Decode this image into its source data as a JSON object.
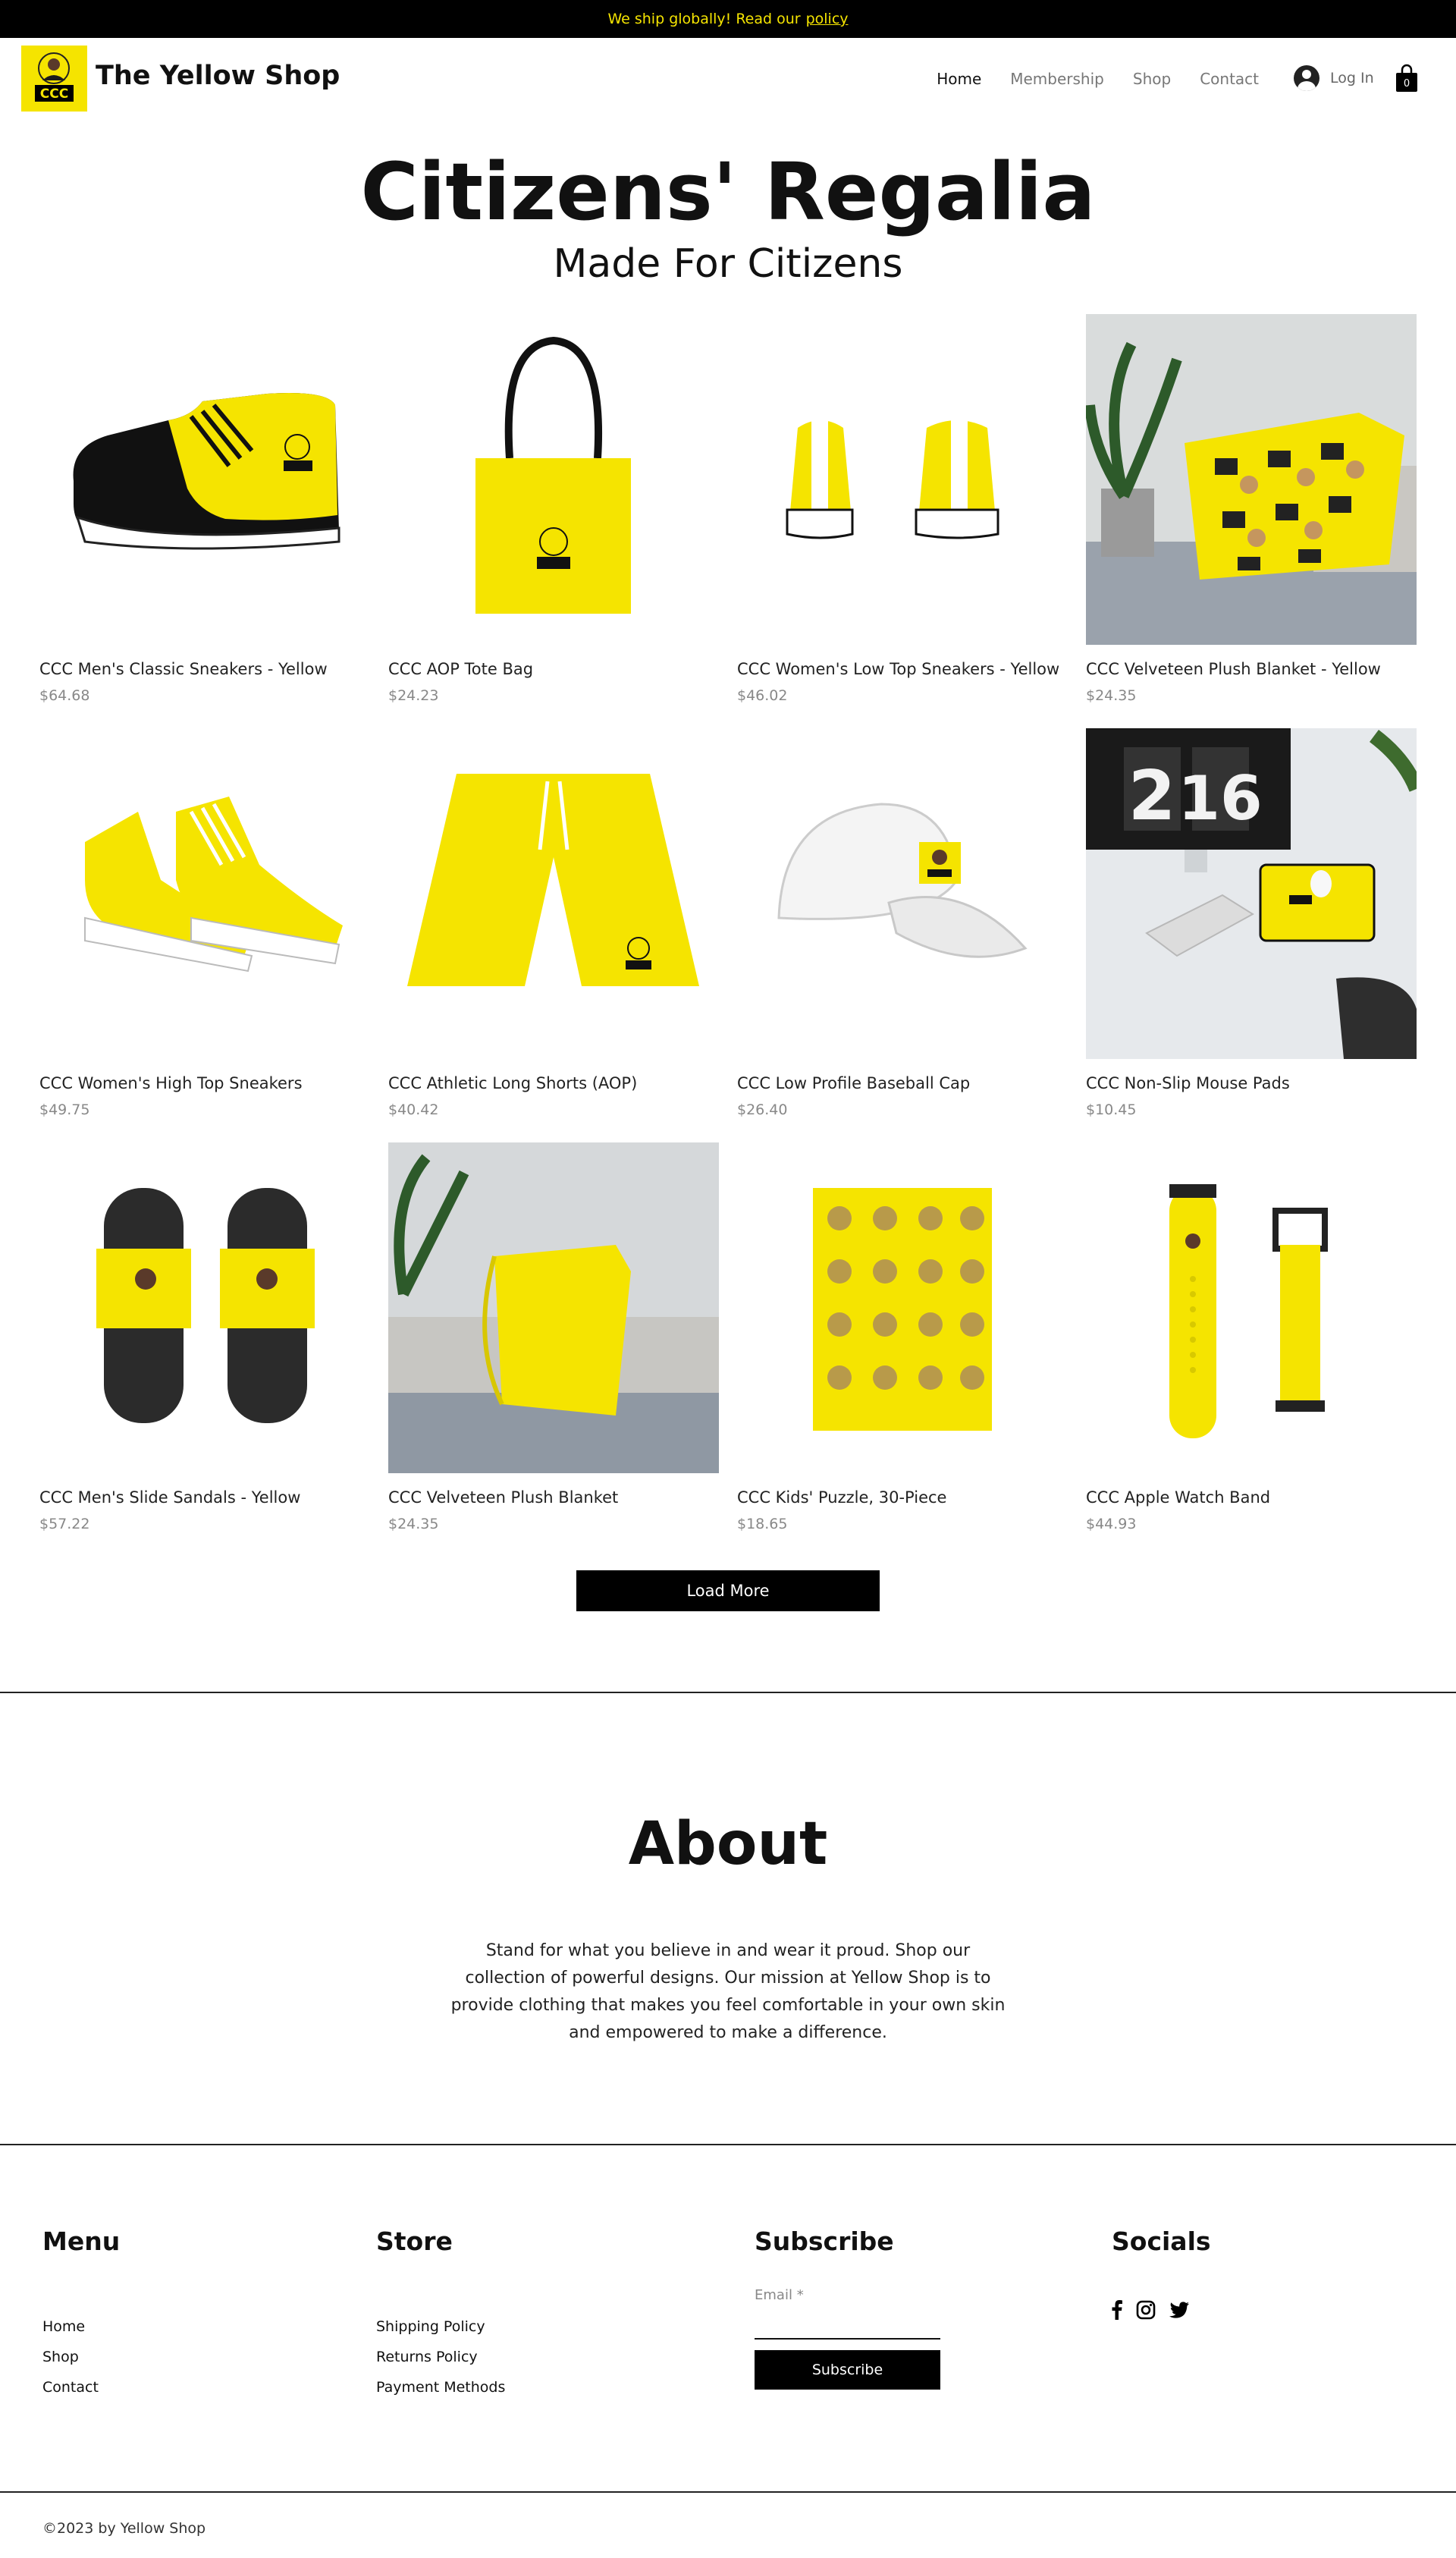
{
  "banner": {
    "text": "We ship globally! Read our",
    "link": "policy"
  },
  "header": {
    "logo_text": "CCC",
    "site_title": "The Yellow Shop",
    "nav": [
      "Home",
      "Membership",
      "Shop",
      "Contact"
    ],
    "active_nav": "Home",
    "login_label": "Log In",
    "cart_count": "0"
  },
  "hero": {
    "title": "Citizens' Regalia",
    "subtitle": "Made For Citizens"
  },
  "products": [
    {
      "name": "CCC Men's Classic Sneakers - Yellow",
      "price": "$64.68"
    },
    {
      "name": "CCC AOP Tote Bag",
      "price": "$24.23"
    },
    {
      "name": "CCC Women's Low Top Sneakers - Yellow",
      "price": "$46.02"
    },
    {
      "name": "CCC Velveteen Plush Blanket - Yellow",
      "price": "$24.35"
    },
    {
      "name": "CCC Women's High Top Sneakers",
      "price": "$49.75"
    },
    {
      "name": "CCC Athletic Long Shorts (AOP)",
      "price": "$40.42"
    },
    {
      "name": "CCC Low Profile Baseball Cap",
      "price": "$26.40"
    },
    {
      "name": "CCC Non-Slip Mouse Pads",
      "price": "$10.45"
    },
    {
      "name": "CCC Men's Slide Sandals - Yellow",
      "price": "$57.22"
    },
    {
      "name": "CCC Velveteen Plush Blanket",
      "price": "$24.35"
    },
    {
      "name": "CCC Kids' Puzzle, 30-Piece",
      "price": "$18.65"
    },
    {
      "name": "CCC Apple Watch Band",
      "price": "$44.93"
    }
  ],
  "load_more": "Load More",
  "about": {
    "title": "About",
    "text": "Stand for what you believe in and wear it proud. Shop our collection of powerful designs. Our mission at Yellow Shop is to provide clothing that makes you feel comfortable in your own skin and empowered to make a difference."
  },
  "footer": {
    "menu": {
      "title": "Menu",
      "links": [
        "Home",
        "Shop",
        "Contact"
      ]
    },
    "store": {
      "title": "Store",
      "links": [
        "Shipping Policy",
        "Returns Policy",
        "Payment Methods"
      ]
    },
    "subscribe": {
      "title": "Subscribe",
      "email_label": "Email",
      "required_mark": "*",
      "button": "Subscribe"
    },
    "socials": {
      "title": "Socials",
      "icons": [
        "facebook-icon",
        "instagram-icon",
        "twitter-icon"
      ]
    },
    "copyright": "©2023 by Yellow Shop"
  },
  "colors": {
    "brand_yellow": "#f5e400",
    "black": "#000000",
    "muted": "#888888"
  },
  "clock_digits": [
    "2",
    "16"
  ]
}
